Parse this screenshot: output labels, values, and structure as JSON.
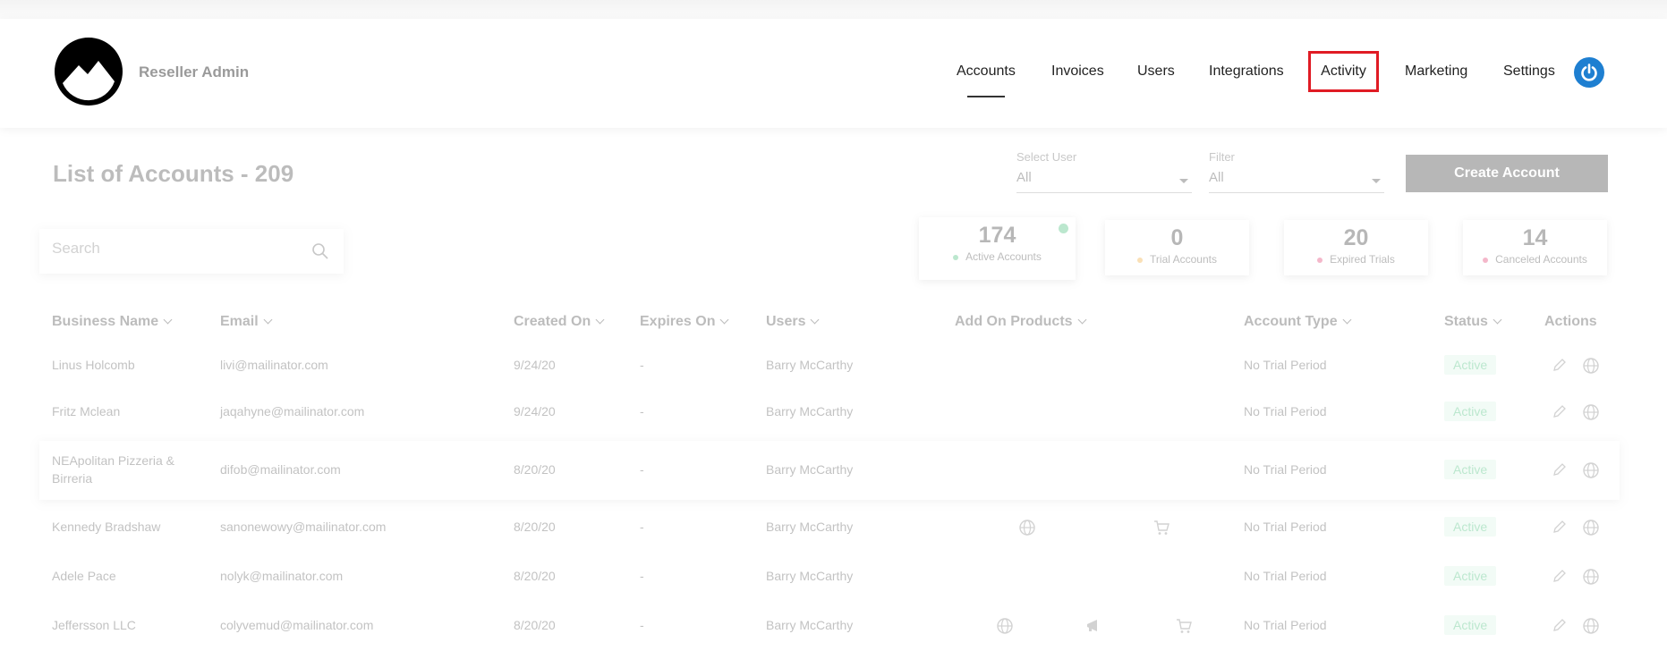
{
  "header": {
    "brand": "Reseller Admin",
    "nav": {
      "accounts": "Accounts",
      "invoices": "Invoices",
      "users": "Users",
      "integrations": "Integrations",
      "activity": "Activity",
      "marketing": "Marketing",
      "settings": "Settings"
    },
    "highlight_color": "#e01b24",
    "power_color": "#1e7fd1"
  },
  "page": {
    "title": "List of Accounts - 209",
    "select_user": {
      "label": "Select User",
      "value": "All"
    },
    "filter": {
      "label": "Filter",
      "value": "All"
    },
    "create_button": "Create Account",
    "search_placeholder": "Search"
  },
  "stats": [
    {
      "value": "174",
      "label": "Active Accounts",
      "color": "#2fb86a"
    },
    {
      "value": "0",
      "label": "Trial Accounts",
      "color": "#f0a020"
    },
    {
      "value": "20",
      "label": "Expired Trials",
      "color": "#e0245e"
    },
    {
      "value": "14",
      "label": "Canceled Accounts",
      "color": "#e0245e"
    }
  ],
  "table": {
    "columns": [
      "Business Name",
      "Email",
      "Created On",
      "Expires On",
      "Users",
      "Add On Products",
      "Account Type",
      "Status",
      "Actions"
    ],
    "rows": [
      {
        "name": "Linus Holcomb",
        "email": "livi@mailinator.com",
        "created": "9/24/20",
        "expires": "-",
        "users": "Barry McCarthy",
        "addons": [],
        "type": "No Trial Period",
        "status": "Active"
      },
      {
        "name": "Fritz Mclean",
        "email": "jaqahyne@mailinator.com",
        "created": "9/24/20",
        "expires": "-",
        "users": "Barry McCarthy",
        "addons": [],
        "type": "No Trial Period",
        "status": "Active"
      },
      {
        "name": "NEApolitan Pizzeria & Birreria",
        "email": "difob@mailinator.com",
        "created": "8/20/20",
        "expires": "-",
        "users": "Barry McCarthy",
        "addons": [],
        "type": "No Trial Period",
        "status": "Active"
      },
      {
        "name": "Kennedy Bradshaw",
        "email": "sanonewowy@mailinator.com",
        "created": "8/20/20",
        "expires": "-",
        "users": "Barry McCarthy",
        "addons": [
          "globe-icon",
          "cart-icon"
        ],
        "type": "No Trial Period",
        "status": "Active"
      },
      {
        "name": "Adele Pace",
        "email": "nolyk@mailinator.com",
        "created": "8/20/20",
        "expires": "-",
        "users": "Barry McCarthy",
        "addons": [],
        "type": "No Trial Period",
        "status": "Active"
      },
      {
        "name": "Jeffersson LLC",
        "email": "colyvemud@mailinator.com",
        "created": "8/20/20",
        "expires": "-",
        "users": "Barry McCarthy",
        "addons": [
          "globe-icon",
          "megaphone-icon",
          "cart-icon"
        ],
        "type": "No Trial Period",
        "status": "Active"
      }
    ]
  }
}
